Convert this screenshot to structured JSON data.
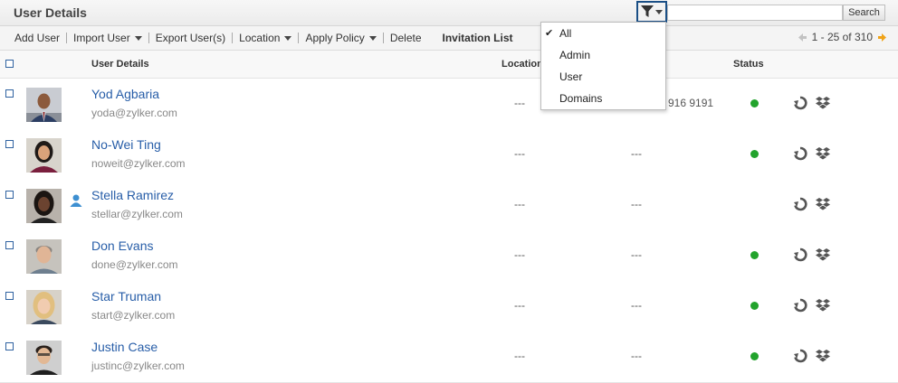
{
  "header": {
    "title": "User Details",
    "search_placeholder": "",
    "search_button": "Search"
  },
  "toolbar": {
    "add_user": "Add User",
    "import_user": "Import User",
    "export_users": "Export User(s)",
    "location": "Location",
    "apply_policy": "Apply Policy",
    "delete": "Delete",
    "invitation_list": "Invitation List"
  },
  "pager": {
    "range": "1 - 25 of 310"
  },
  "columns": {
    "user_details": "User Details",
    "location": "Location",
    "phone": "",
    "status": "Status"
  },
  "filter_menu": {
    "items": [
      "All",
      "Admin",
      "User",
      "Domains"
    ],
    "selected": "All"
  },
  "users": [
    {
      "name": "Yod Agbaria",
      "email": "yoda@zylker.com",
      "location": "---",
      "phone": "916 9191",
      "status": "active",
      "admin": false
    },
    {
      "name": "No-Wei Ting",
      "email": "noweit@zylker.com",
      "location": "---",
      "phone": "---",
      "status": "active",
      "admin": false
    },
    {
      "name": "Stella Ramirez",
      "email": "stellar@zylker.com",
      "location": "---",
      "phone": "---",
      "status": "none",
      "admin": true
    },
    {
      "name": "Don Evans",
      "email": "done@zylker.com",
      "location": "---",
      "phone": "---",
      "status": "active",
      "admin": false
    },
    {
      "name": "Star Truman",
      "email": "start@zylker.com",
      "location": "---",
      "phone": "---",
      "status": "active",
      "admin": false
    },
    {
      "name": "Justin Case",
      "email": "justinc@zylker.com",
      "location": "---",
      "phone": "---",
      "status": "active",
      "admin": false
    }
  ],
  "colors": {
    "link": "#285ea8",
    "status_active": "#22a32c",
    "filter_border": "#1a4f86"
  },
  "icons": [
    "filter-icon",
    "prev-page-icon",
    "next-page-icon",
    "admin-user-icon",
    "reset-password-icon",
    "dropbox-icon"
  ]
}
